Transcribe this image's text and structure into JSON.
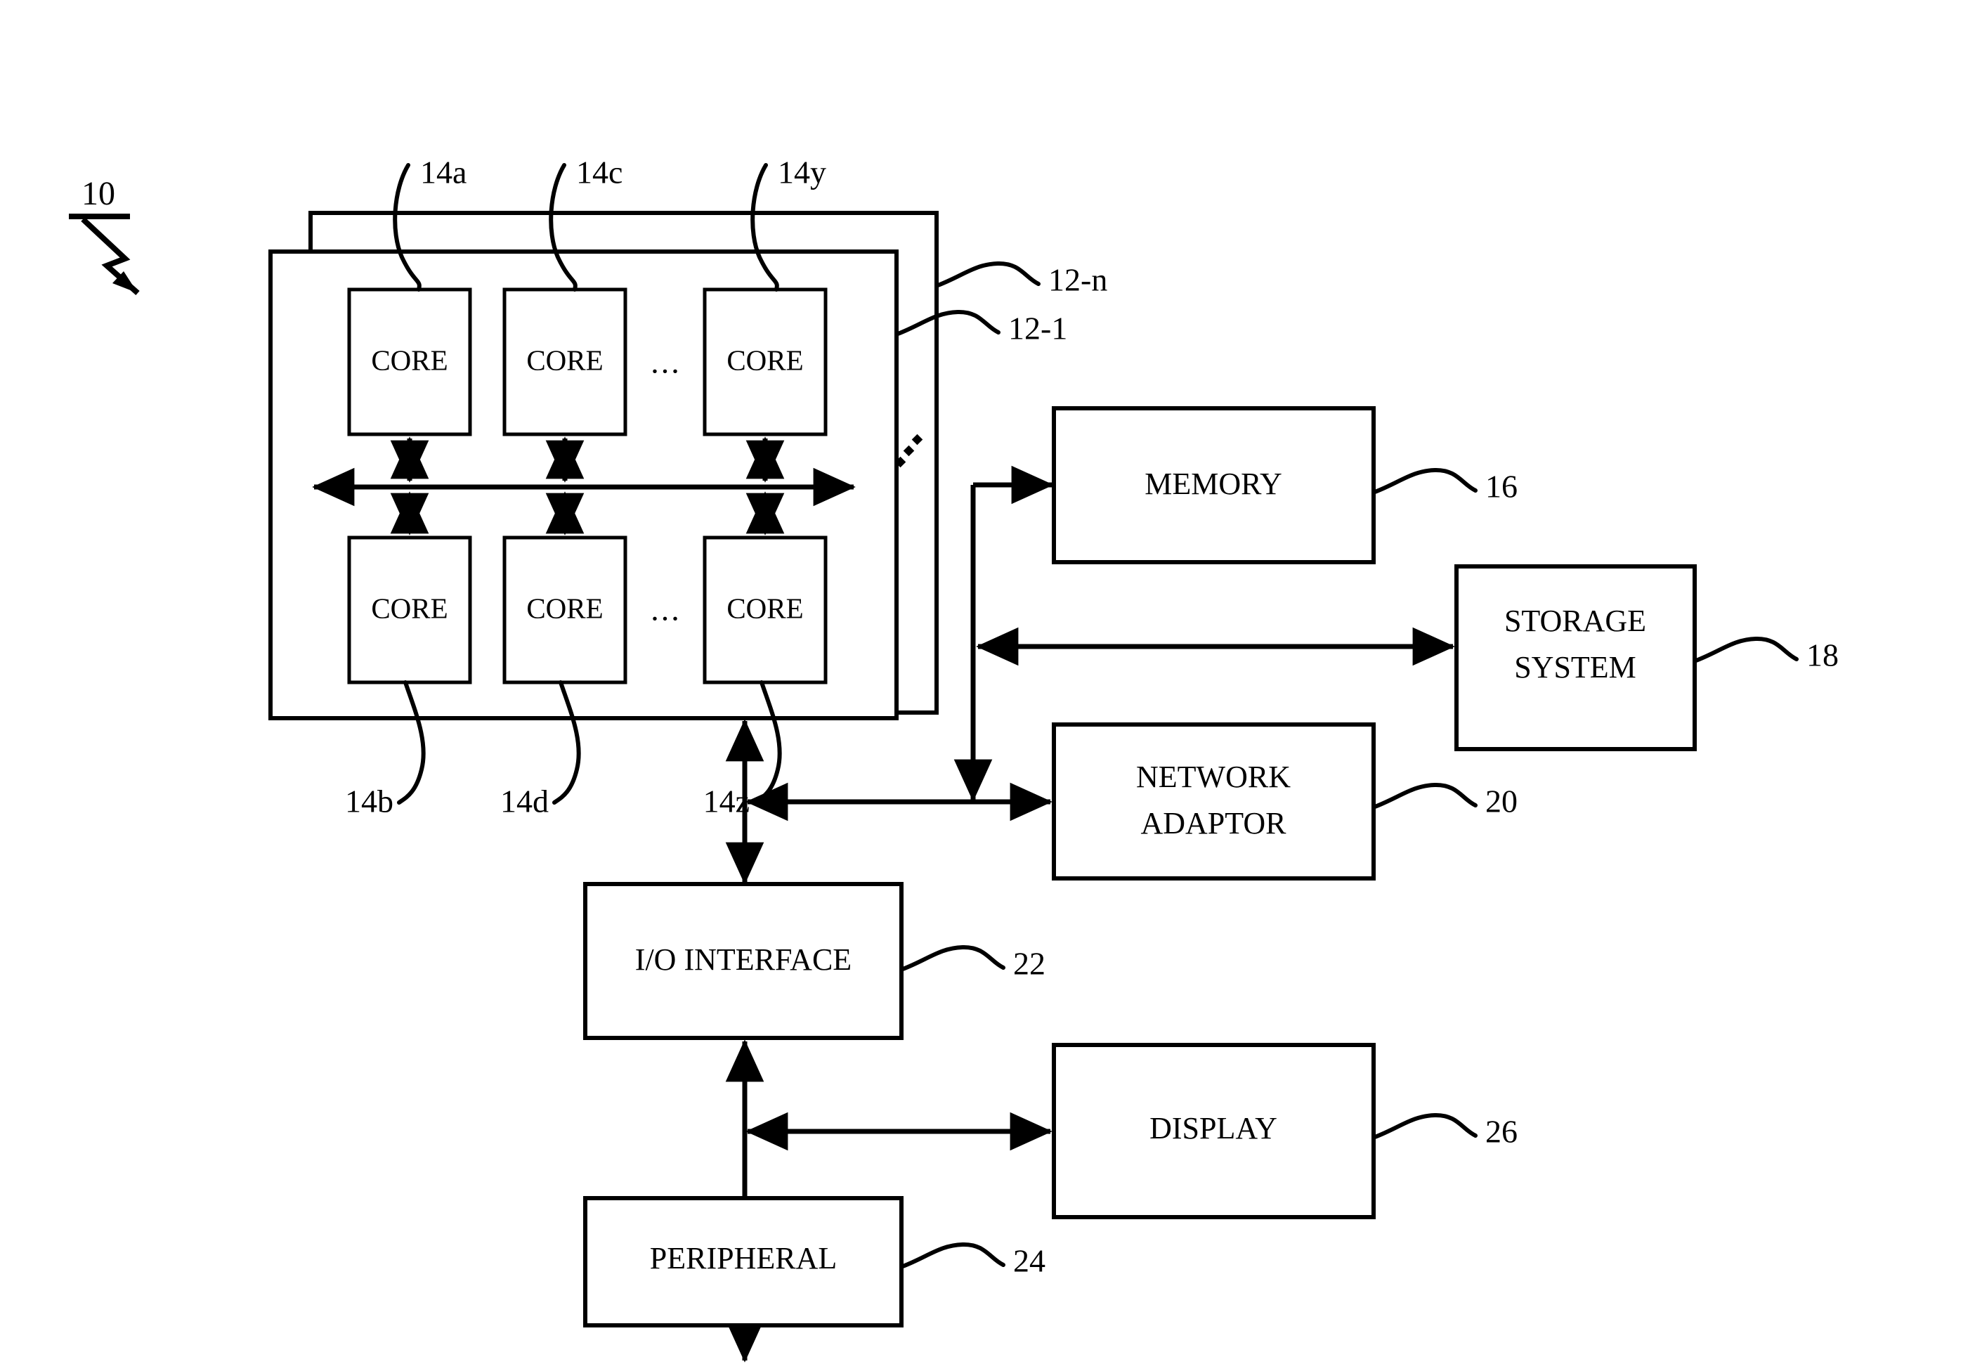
{
  "figure": {
    "figure_ref": "10",
    "background_color": "#ffffff",
    "line_color": "#000000"
  },
  "processor_stack": {
    "back_box_ref": "12-n",
    "front_box_ref": "12-1",
    "stack_ellipsis": "..."
  },
  "cores": {
    "label": "CORE",
    "row_ellipsis": "...",
    "top_row": [
      {
        "label": "CORE",
        "ref": "14a"
      },
      {
        "label": "CORE",
        "ref": "14c"
      },
      {
        "label": "CORE",
        "ref": "14y"
      }
    ],
    "bottom_row": [
      {
        "label": "CORE",
        "ref": "14b"
      },
      {
        "label": "CORE",
        "ref": "14d"
      },
      {
        "label": "CORE",
        "ref": "14z"
      }
    ]
  },
  "blocks": {
    "memory": {
      "label": "MEMORY",
      "ref": "16"
    },
    "storage": {
      "label_line1": "STORAGE",
      "label_line2": "SYSTEM",
      "ref": "18"
    },
    "network": {
      "label_line1": "NETWORK",
      "label_line2": "ADAPTOR",
      "ref": "20"
    },
    "io": {
      "label": "I/O INTERFACE",
      "ref": "22"
    },
    "peripheral": {
      "label": "PERIPHERAL",
      "ref": "24"
    },
    "display": {
      "label": "DISPLAY",
      "ref": "26"
    }
  }
}
